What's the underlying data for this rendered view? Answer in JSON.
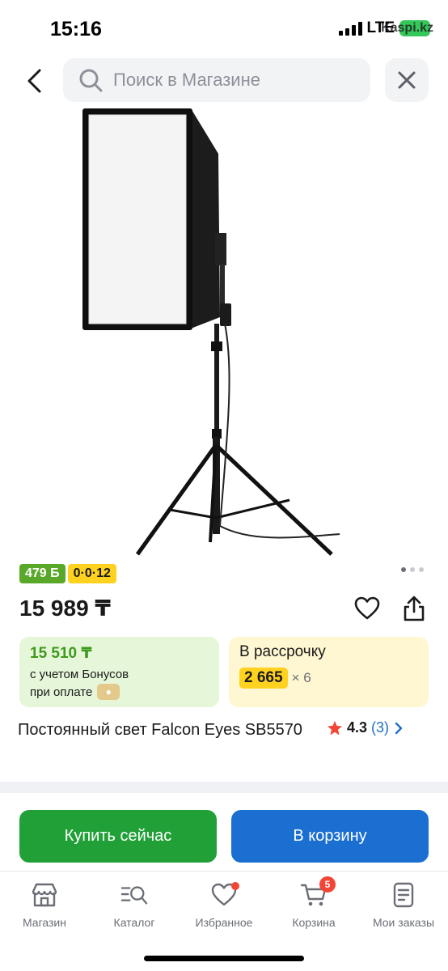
{
  "status_bar": {
    "time": "15:16",
    "network": "LTE",
    "watermark": "Kaspi.kz"
  },
  "search": {
    "placeholder": "Поиск в Магазине"
  },
  "product": {
    "image_icon": "softbox-light-stand-image",
    "bonus_badge": "479 Б",
    "installment_badge": "0·0·12",
    "gallery_pages": 3,
    "gallery_current": 1,
    "price": "15 989 ₸",
    "title": "Постоянный свет Falcon Eyes SB5570",
    "rating": "4.3",
    "reviews": "(3)"
  },
  "bonus_card": {
    "price": "15 510 ₸",
    "line1": "с учетом Бонусов",
    "line2": "при оплате",
    "coin_icon": "kaspi-gold-icon"
  },
  "installment_card": {
    "title": "В рассрочку",
    "amount": "2 665",
    "multiplier": "× 6"
  },
  "actions": {
    "buy_now": "Купить сейчас",
    "add_to_cart": "В корзину"
  },
  "tabs": [
    {
      "label": "Магазин",
      "icon": "store-icon"
    },
    {
      "label": "Каталог",
      "icon": "catalog-search-icon"
    },
    {
      "label": "Избранное",
      "icon": "heart-icon",
      "dot": true
    },
    {
      "label": "Корзина",
      "icon": "cart-icon",
      "badge": "5"
    },
    {
      "label": "Мои заказы",
      "icon": "orders-icon"
    }
  ],
  "colors": {
    "green": "#21a038",
    "blue": "#1a6fd1",
    "yellow": "#ffd21f",
    "bonus_green": "#5aa82a",
    "red": "#f14635"
  }
}
